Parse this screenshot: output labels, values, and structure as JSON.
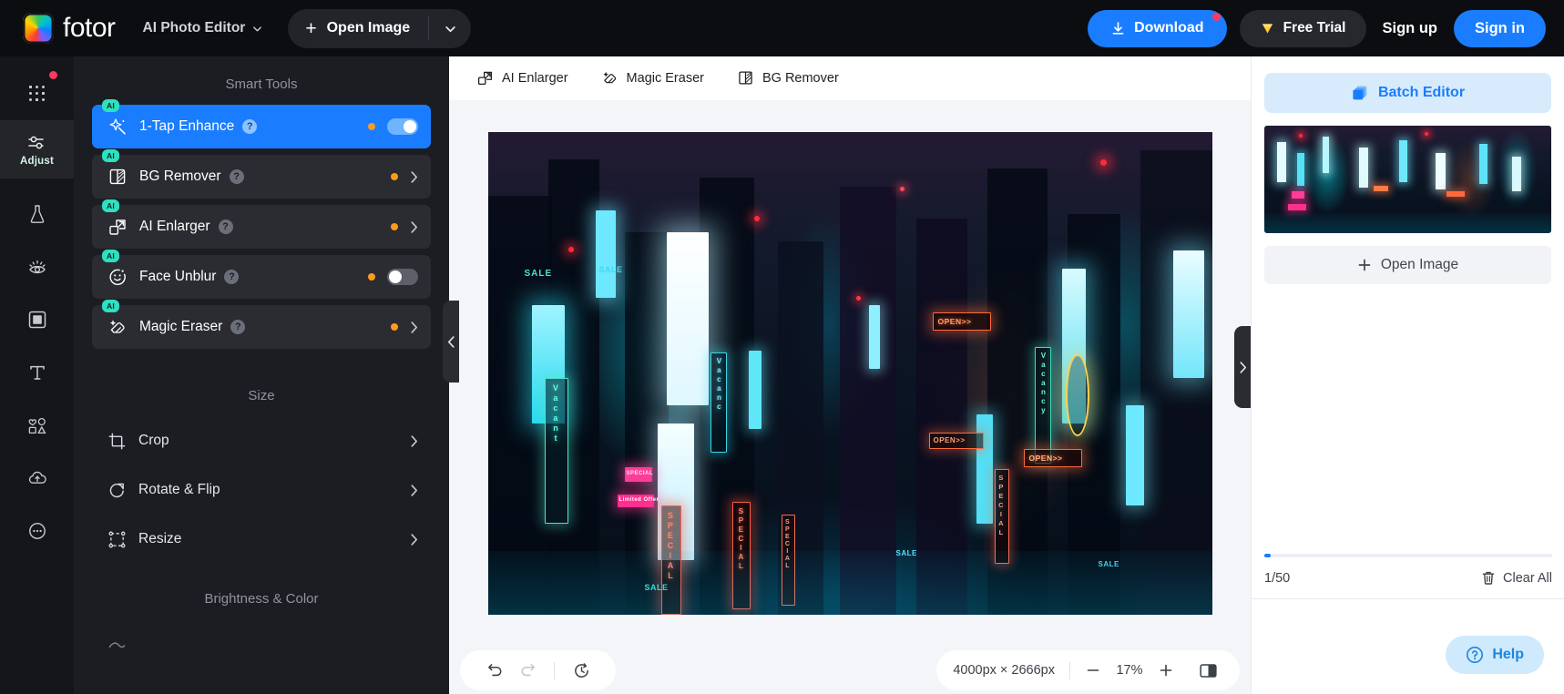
{
  "topbar": {
    "brand_name": "fotor",
    "brand_icon": "fotor-logo-icon",
    "mode_label": "AI Photo Editor",
    "mode_caret_icon": "chevron-down-icon",
    "open_image_label": "Open Image",
    "open_plus_icon": "plus-icon",
    "open_caret_icon": "chevron-down-icon",
    "download_label": "Download",
    "download_icon": "download-icon",
    "free_trial_label": "Free Trial",
    "free_trial_icon": "diamond-icon",
    "sign_up_label": "Sign up",
    "sign_in_label": "Sign in",
    "accent_blue": "#1a7dff",
    "badge_red": "#ff3860"
  },
  "rail": {
    "items": [
      {
        "label": "",
        "icon": "apps-grid-icon",
        "active": false,
        "badge": true
      },
      {
        "label": "Adjust",
        "icon": "sliders-icon",
        "active": true,
        "badge": false
      },
      {
        "label": "",
        "icon": "flask-effects-icon",
        "active": false,
        "badge": false
      },
      {
        "label": "",
        "icon": "retouch-eye-icon",
        "active": false,
        "badge": false
      },
      {
        "label": "",
        "icon": "frame-square-icon",
        "active": false,
        "badge": false
      },
      {
        "label": "",
        "icon": "text-tool-icon",
        "active": false,
        "badge": false
      },
      {
        "label": "",
        "icon": "elements-shapes-icon",
        "active": false,
        "badge": false
      },
      {
        "label": "",
        "icon": "cloud-upload-icon",
        "active": false,
        "badge": false
      },
      {
        "label": "",
        "icon": "more-options-icon",
        "active": false,
        "badge": false
      }
    ]
  },
  "panel": {
    "smart_tools_title": "Smart Tools",
    "ai_badge": "AI",
    "help_glyph": "?",
    "tools": [
      {
        "label": "1-Tap Enhance",
        "icon": "magic-wand-icon",
        "selected": true,
        "control": "toggle",
        "toggle_on": true
      },
      {
        "label": "BG Remover",
        "icon": "bg-remover-icon",
        "selected": false,
        "control": "chevron",
        "toggle_on": false
      },
      {
        "label": "AI Enlarger",
        "icon": "enlarge-icon",
        "selected": false,
        "control": "chevron",
        "toggle_on": false
      },
      {
        "label": "Face Unblur",
        "icon": "face-smile-icon",
        "selected": false,
        "control": "toggle",
        "toggle_on": false
      },
      {
        "label": "Magic Eraser",
        "icon": "eraser-icon",
        "selected": false,
        "control": "chevron",
        "toggle_on": false
      }
    ],
    "size_title": "Size",
    "size_items": [
      {
        "label": "Crop",
        "icon": "crop-icon"
      },
      {
        "label": "Rotate & Flip",
        "icon": "rotate-icon"
      },
      {
        "label": "Resize",
        "icon": "resize-icon"
      }
    ],
    "brightness_title": "Brightness & Color",
    "collapse_icon": "chevron-left-icon"
  },
  "canvas": {
    "toolbar": [
      {
        "label": "AI Enlarger",
        "icon": "enlarge-icon"
      },
      {
        "label": "Magic Eraser",
        "icon": "eraser-icon"
      },
      {
        "label": "BG Remover",
        "icon": "bg-remover-icon"
      }
    ],
    "expand_icon": "chevron-right-icon",
    "image_alt": "neon-city-street-photo",
    "neon_signs": [
      "Vacancy",
      "SPECIAL",
      "OPEN>>",
      "Vacancy",
      "SPECIAL",
      "OPEN>>",
      "OPEN>>",
      "SALE",
      "Limited Offer"
    ]
  },
  "statusbar": {
    "undo_icon": "undo-icon",
    "redo_icon": "redo-icon",
    "history_icon": "history-clock-icon",
    "dimensions": "4000px × 2666px",
    "zoom_out_icon": "minus-icon",
    "zoom_value": "17%",
    "zoom_in_icon": "plus-icon",
    "compare_icon": "compare-split-icon"
  },
  "right_panel": {
    "batch_editor_label": "Batch Editor",
    "batch_editor_icon": "layers-stack-icon",
    "thumbnail_alt": "neon-city-thumbnail",
    "open_image_label": "Open Image",
    "open_image_icon": "plus-icon",
    "count_label": "1/50",
    "clear_all_label": "Clear All",
    "clear_all_icon": "trash-icon",
    "help_label": "Help",
    "help_icon": "question-circle-icon",
    "batch_bg": "#d7ebfd",
    "help_bg": "#cfe9fd"
  }
}
